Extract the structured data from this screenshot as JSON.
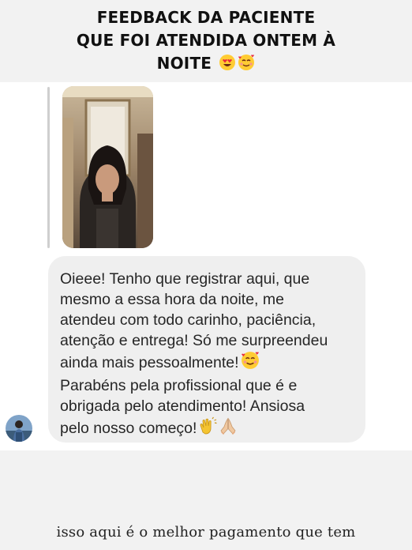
{
  "header": {
    "title_line1": "FEEDBACK DA PACIENTE",
    "title_line2": "QUE FOI ATENDIDA ONTEM À",
    "title_line3": "NOITE"
  },
  "message": {
    "part1": "Oieee! Tenho que registrar aqui, que\nmesmo a essa hora da noite, me\natendeu com todo carinho, paciência,\natenção e entrega! Só me surpreendeu\nainda mais pessoalmente!",
    "part2": "Parabéns pela profissional que é e\nobrigada pelo atendimento! Ansiosa\npelo nosso começo!"
  },
  "footer": {
    "caption": "isso aqui é o melhor pagamento que tem"
  },
  "icons": {
    "title_emojis": [
      "heart-eyes-emoji-icon",
      "smiling-face-with-hearts-emoji-icon"
    ],
    "inline_emoji": "smiling-face-with-hearts-emoji-icon",
    "end_emojis": [
      "clapping-hands-emoji-icon",
      "folded-hands-emoji-icon"
    ]
  },
  "colors": {
    "bubble_bg": "#efefef",
    "header_bg": "#f2f2f2",
    "text": "#262626"
  }
}
